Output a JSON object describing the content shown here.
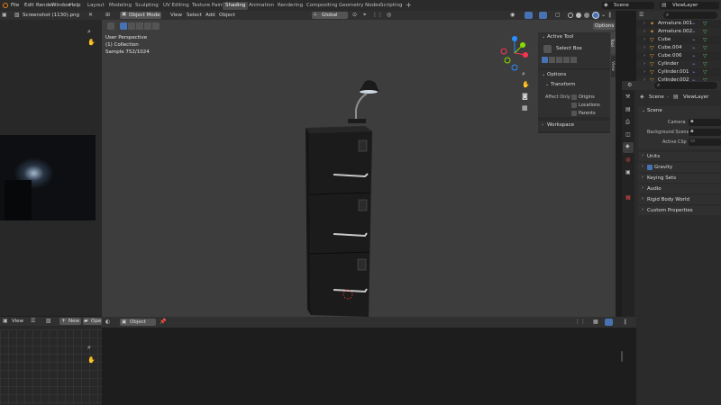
{
  "topbar": {
    "menus": [
      "File",
      "Edit",
      "Render",
      "Window",
      "Help"
    ],
    "workspaces": [
      "Layout",
      "Modeling",
      "Sculpting",
      "UV Editing",
      "Texture Paint",
      "Shading",
      "Animation",
      "Rendering",
      "Compositing",
      "Geometry Nodes",
      "Scripting"
    ],
    "active_workspace": "Shading",
    "scene_name": "Scene",
    "view_layer_name": "ViewLayer"
  },
  "image_editor": {
    "image_name": "Screenshot (1130).png"
  },
  "viewport": {
    "mode": "Object Mode",
    "menus": [
      "View",
      "Select",
      "Add",
      "Object"
    ],
    "orientation": "Global",
    "info_line1": "User Perspective",
    "info_line2": "(1) Collection",
    "info_line3": "Sample 752/1024",
    "options_label": "Options"
  },
  "npanel": {
    "tabs": [
      "Tool",
      "View"
    ],
    "active_tool_title": "Active Tool",
    "tool_name": "Select Box",
    "options_title": "Options",
    "transform_title": "Transform",
    "affect_only_label": "Affect Only",
    "affect_items": [
      "Origins",
      "Locations",
      "Parents"
    ],
    "workspace_title": "Workspace"
  },
  "outliner": {
    "items": [
      {
        "name": "Armature.001",
        "icon": "armature-icon"
      },
      {
        "name": "Armature.002",
        "icon": "armature-icon"
      },
      {
        "name": "Cube",
        "icon": "mesh-icon"
      },
      {
        "name": "Cube.004",
        "icon": "mesh-icon"
      },
      {
        "name": "Cube.006",
        "icon": "mesh-icon"
      },
      {
        "name": "Cylinder",
        "icon": "mesh-icon"
      },
      {
        "name": "Cylinder.001",
        "icon": "mesh-icon"
      },
      {
        "name": "Cylinder.002",
        "icon": "mesh-icon"
      }
    ]
  },
  "properties": {
    "breadcrumb_scene": "Scene",
    "breadcrumb_layer": "ViewLayer",
    "scene_section": "Scene",
    "camera_label": "Camera",
    "background_label": "Background Scene",
    "active_clip_label": "Active Clip",
    "sections": [
      "Units",
      "Gravity",
      "Keying Sets",
      "Audio",
      "Rigid Body World",
      "Custom Properties"
    ],
    "gravity_checked": true
  },
  "node_editor": {
    "view_label": "View",
    "new_label": "New",
    "open_label": "Ope",
    "object_label": "Object"
  },
  "colors": {
    "accent": "#4772b3",
    "active_tab": "#4a4a4a",
    "viewport_bg": "#3d3d3d",
    "axis_x": "#ff3352",
    "axis_y": "#8bdc00",
    "axis_z": "#2890ff"
  }
}
